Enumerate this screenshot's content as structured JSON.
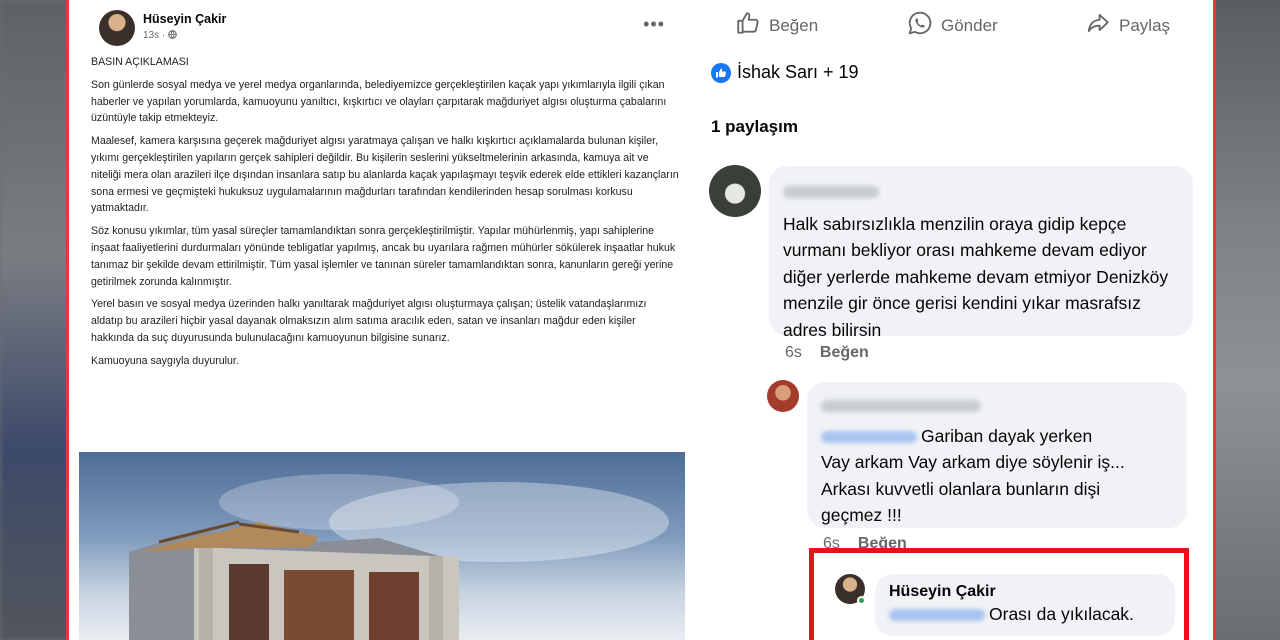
{
  "post": {
    "author": "Hüseyin Çakir",
    "time": "13s",
    "privacy_icon": "globe-icon",
    "more_icon": "ellipsis-icon",
    "paragraphs": [
      "BASIN AÇIKLAMASI",
      "Son günlerde sosyal medya ve yerel medya organlarında, belediyemizce gerçekleştirilen kaçak yapı yıkımlarıyla ilgili çıkan haberler ve yapılan yorumlarda, kamuoyunu yanıltıcı, kışkırtıcı ve olayları çarpıtarak mağduriyet algısı oluşturma çabalarını üzüntüyle takip etmekteyiz.",
      "Maalesef, kamera karşısına geçerek mağduriyet algısı yaratmaya çalışan ve halkı kışkırtıcı açıklamalarda bulunan kişiler, yıkımı gerçekleştirilen yapıların gerçek sahipleri değildir. Bu kişilerin seslerini yükseltmelerinin arkasında, kamuya ait ve niteliği mera olan arazileri ilçe dışından insanlara satıp bu alanlarda kaçak yapılaşmayı teşvik ederek elde ettikleri kazançların sona ermesi ve geçmişteki hukuksuz uygulamalarının mağdurları tarafından kendilerinden hesap sorulması korkusu yatmaktadır.",
      "Söz konusu yıkımlar, tüm yasal süreçler tamamlandıktan sonra gerçekleştirilmiştir. Yapılar mühürlenmiş, yapı sahiplerine inşaat faaliyetlerini durdurmaları yönünde tebligatlar yapılmış, ancak bu uyarılara rağmen mühürler sökülerek inşaatlar hukuk tanımaz bir şekilde devam ettirilmiştir. Tüm yasal işlemler ve tanınan süreler tamamlandıktan sonra, kanunların gereği yerine getirilmek zorunda kalınmıştır.",
      "Yerel basın ve sosyal medya üzerinden halkı yanıltarak mağduriyet algısı oluşturmaya çalışan; üstelik vatandaşlarımızı aldatıp bu arazileri hiçbir yasal dayanak olmaksızın alım satıma aracılık eden, satan ve insanları mağdur eden kişiler hakkında da suç duyurusunda bulunulacağını kamuoyunun bilgisine sunarız.",
      "Kamuoyuna saygıyla duyurulur."
    ]
  },
  "actions": {
    "like": "Beğen",
    "send": "Gönder",
    "share": "Paylaş"
  },
  "reactions": {
    "text": "İshak Sarı + 19"
  },
  "shares": "1 paylaşım",
  "comments": [
    {
      "text": "Halk sabırsızlıkla menzilin oraya gidip kepçe vurmanı bekliyor orası mahkeme devam ediyor diğer yerlerde mahkeme devam etmiyor Denizköy menzile gir önce gerisi kendini yıkar masrafsız adres bilirsin",
      "time": "6s",
      "like": "Beğen"
    },
    {
      "text": "Gariban dayak yerken Vay arkam Vay arkam diye söylenir iş... Arkası kuvvetli olanlara bunların dişi geçmez !!!",
      "line1": "Gariban dayak yerken",
      "line2": "Vay arkam Vay arkam diye söylenir iş...",
      "line3": "Arkası kuvvetli olanlara bunların dişi",
      "line4": "geçmez !!!",
      "time": "6s",
      "like": "Beğen"
    },
    {
      "author": "Hüseyin Çakir",
      "text": "Orası da yıkılacak."
    }
  ],
  "colors": {
    "highlight": "#e5141b",
    "facebook_blue": "#1877f2"
  }
}
